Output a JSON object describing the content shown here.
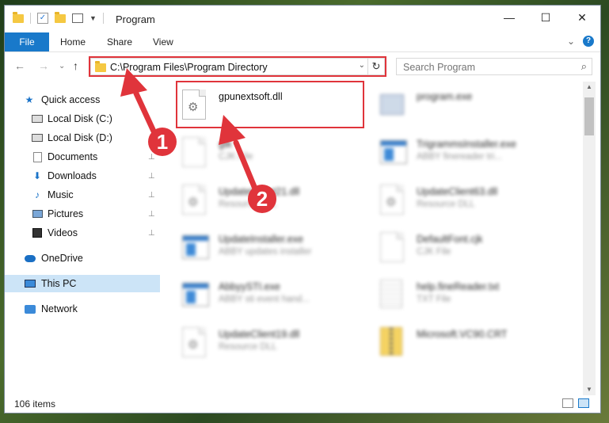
{
  "window": {
    "title": "Program",
    "minimize_glyph": "—",
    "maximize_glyph": "☐",
    "close_glyph": "✕"
  },
  "ribbon": {
    "tabs": [
      "File",
      "Home",
      "Share",
      "View"
    ],
    "expand_glyph": "⌄",
    "help_glyph": "?"
  },
  "nav": {
    "back_glyph": "←",
    "forward_glyph": "→",
    "recent_glyph": "⌄",
    "up_glyph": "↑"
  },
  "address": {
    "path": "C:\\Program Files\\Program Directory",
    "dropdown_glyph": "⌄",
    "refresh_glyph": "↻"
  },
  "search": {
    "placeholder": "Search Program",
    "icon": "search-icon",
    "glyph": "⌕"
  },
  "sidebar": {
    "items": [
      {
        "label": "Quick access",
        "icon": "star-icon",
        "pinned": false
      },
      {
        "label": "Local Disk (C:)",
        "icon": "drive-icon",
        "pinned": false
      },
      {
        "label": "Local Disk (D:)",
        "icon": "drive-icon",
        "pinned": false
      },
      {
        "label": "Documents",
        "icon": "documents-icon",
        "pinned": true
      },
      {
        "label": "Downloads",
        "icon": "download-icon",
        "pinned": true
      },
      {
        "label": "Music",
        "icon": "music-icon",
        "pinned": true
      },
      {
        "label": "Pictures",
        "icon": "pictures-icon",
        "pinned": true
      },
      {
        "label": "Videos",
        "icon": "videos-icon",
        "pinned": true
      },
      {
        "label": "OneDrive",
        "icon": "cloud-icon",
        "pinned": false
      },
      {
        "label": "This PC",
        "icon": "computer-icon",
        "pinned": false,
        "selected": true
      },
      {
        "label": "Network",
        "icon": "network-icon",
        "pinned": false
      }
    ],
    "pin_glyph": "📌"
  },
  "files": [
    {
      "name": "gpunextsoft.dll",
      "desc": "",
      "icon": "dll-file-icon"
    },
    {
      "name": "program.exe",
      "desc": "",
      "icon": "exe-file-icon"
    },
    {
      "name": "gtk",
      "desc": "CJK File",
      "icon": "blank-file-icon"
    },
    {
      "name": "TrigrammsInstaller.exe",
      "desc": "ABBY finereader tri...",
      "icon": "app-file-icon"
    },
    {
      "name": "UpdateClient21.dll",
      "desc": "Resource DLL",
      "icon": "dll-file-icon"
    },
    {
      "name": "UpdateClient63.dll",
      "desc": "Resource DLL",
      "icon": "dll-file-icon"
    },
    {
      "name": "UpdateInstaller.exe",
      "desc": "ABBY updates installer",
      "icon": "app-file-icon"
    },
    {
      "name": "DefaultFont.cjk",
      "desc": "CJK File",
      "icon": "blank-file-icon"
    },
    {
      "name": "AbbyySTI.exe",
      "desc": "ABBY sti event hand...",
      "icon": "app-file-icon"
    },
    {
      "name": "help.fineReader.txt",
      "desc": "TXT File",
      "icon": "text-file-icon"
    },
    {
      "name": "UpdateClient19.dll",
      "desc": "Resource DLL",
      "icon": "dll-file-icon"
    },
    {
      "name": "Microsoft.VC90.CRT",
      "desc": "",
      "icon": "zip-folder-icon"
    }
  ],
  "status": {
    "item_count": "106 items"
  },
  "annotations": {
    "step1": "1",
    "step2": "2",
    "color": "#e0343b"
  },
  "colors": {
    "accent": "#1979ca",
    "highlight_red": "#e0343b",
    "selection": "#cce4f7"
  }
}
